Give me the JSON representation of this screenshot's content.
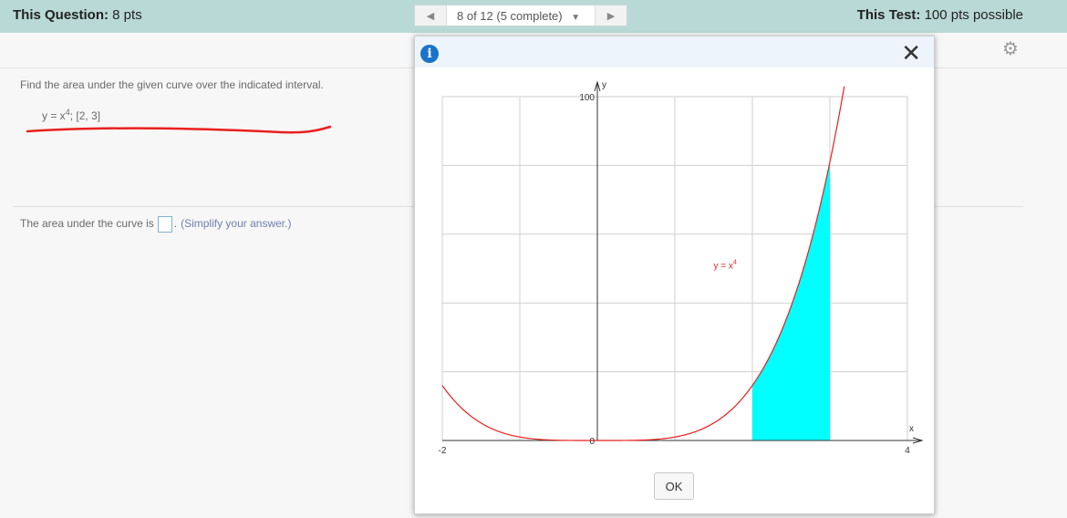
{
  "topbar": {
    "question_label": "This Question:",
    "question_value": "8 pts",
    "nav_status": "8 of 12 (5 complete)",
    "test_label": "This Test:",
    "test_value": "100 pts possible"
  },
  "question": {
    "prompt": "Find the area under the given curve over the indicated interval.",
    "equation_lhs": "y = x",
    "equation_exp": "4",
    "equation_interval": ";   [2, 3]",
    "answer_prefix": "The area under the curve is",
    "answer_suffix": ".",
    "answer_hint": "(Simplify your answer.)"
  },
  "modal": {
    "ok_label": "OK"
  },
  "chart_data": {
    "type": "line",
    "function": "y = x^4",
    "curve_label_base": "y = x",
    "curve_label_exp": "4",
    "xlim": [
      -2,
      4
    ],
    "ylim": [
      0,
      100
    ],
    "xlabel": "x",
    "ylabel": "y",
    "tick_labels": {
      "x_min": "-2",
      "x_max": "4",
      "y_max": "100",
      "origin": "0"
    },
    "shaded_interval": [
      2,
      3
    ],
    "grid": true,
    "colors": {
      "curve": "#e8201e",
      "fill": "#00ffff",
      "grid": "#cfcfcf"
    }
  }
}
